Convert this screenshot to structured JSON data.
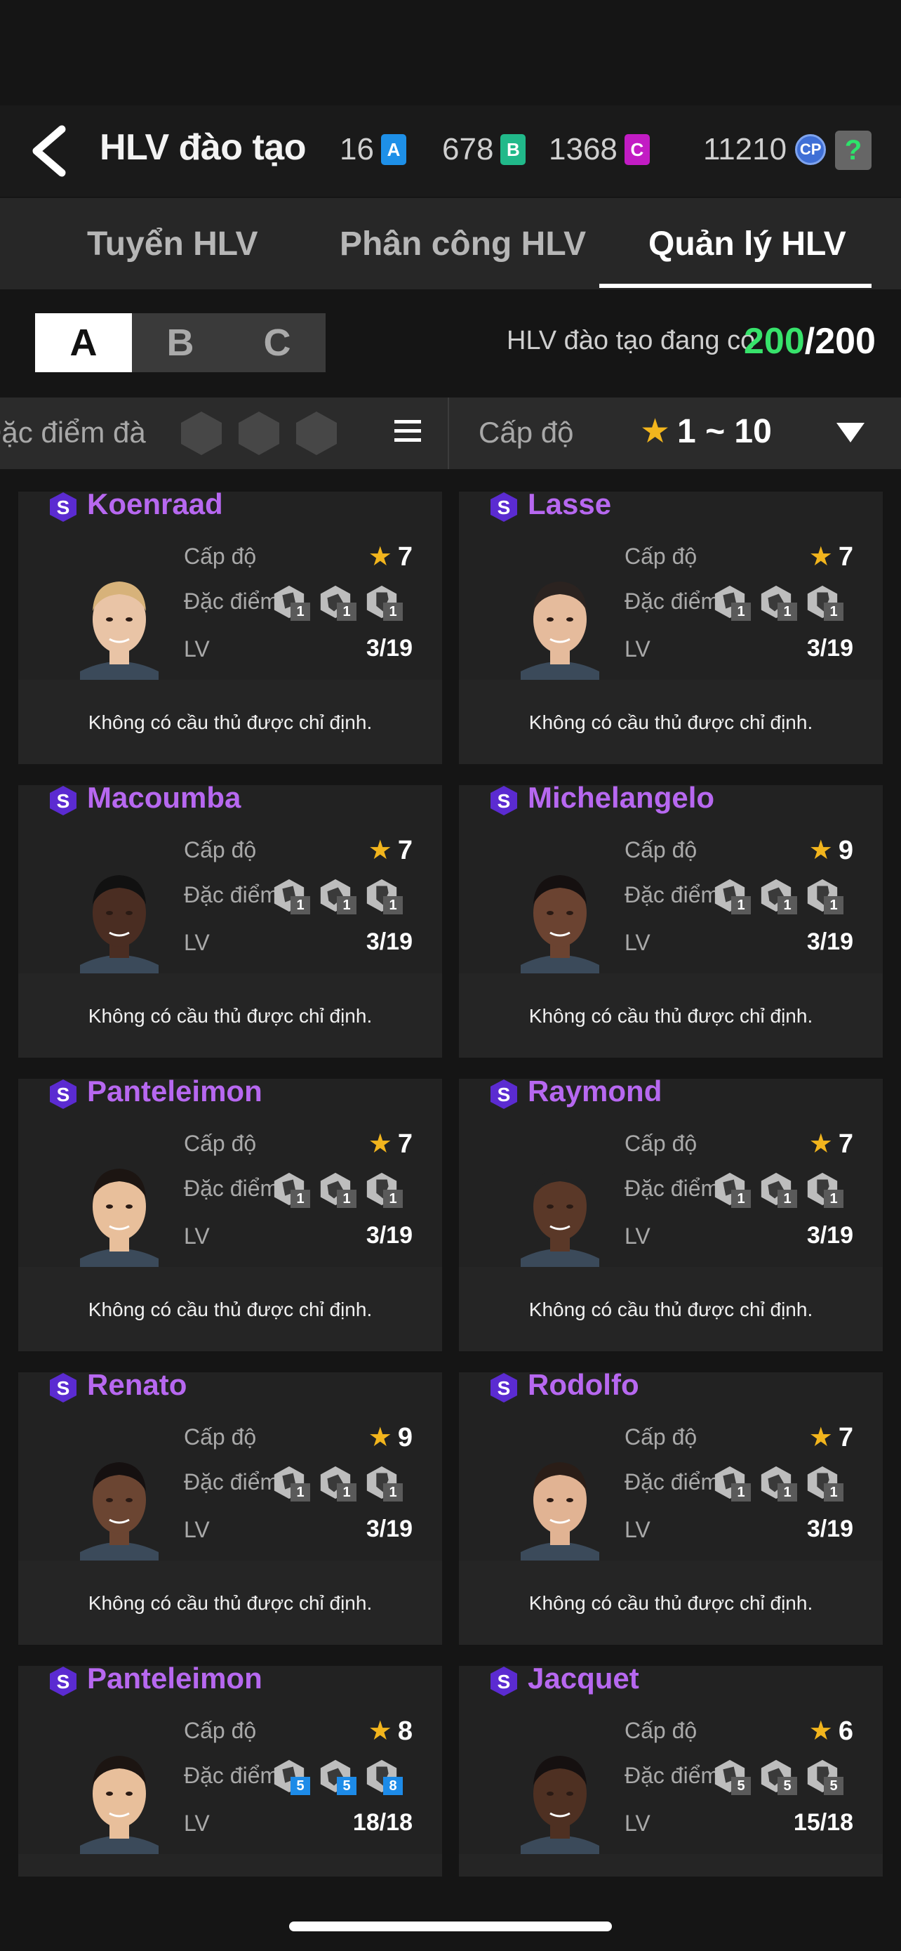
{
  "header": {
    "title": "HLV đào tạo",
    "currencies": [
      {
        "value": "16",
        "chip": "A",
        "color": "#1e90e8"
      },
      {
        "value": "678",
        "chip": "B",
        "color": "#21b98a"
      },
      {
        "value": "1368",
        "chip": "C",
        "color": "#c21cc4"
      }
    ],
    "cp_value": "11210",
    "cp_label": "CP",
    "help_label": "?"
  },
  "tabs": [
    {
      "label": "Tuyển HLV",
      "active": false
    },
    {
      "label": "Phân công HLV",
      "active": false
    },
    {
      "label": "Quản lý HLV",
      "active": true
    }
  ],
  "segments": [
    "A",
    "B",
    "C"
  ],
  "active_segment": "A",
  "count": {
    "label": "HLV đào tạo đang có",
    "current": "200",
    "max": "/200"
  },
  "filter": {
    "trait_label": "Đặc điểm đà",
    "level_label": "Cấp độ",
    "level_range": "1 ~ 10"
  },
  "card_labels": {
    "level": "Cấp độ",
    "traits": "Đặc điểm",
    "lv": "LV",
    "assignment": "Không có cầu thủ được chỉ định."
  },
  "coaches": [
    {
      "name": "Koenraad",
      "stars": "7",
      "lv": "3/19",
      "trait_levels": [
        "1",
        "1",
        "1"
      ],
      "skin": "#e9c4a6",
      "hair": "#d7b27a"
    },
    {
      "name": "Lasse",
      "stars": "7",
      "lv": "3/19",
      "trait_levels": [
        "1",
        "1",
        "1"
      ],
      "skin": "#e5bb9c",
      "hair": "#2b2320"
    },
    {
      "name": "Macoumba",
      "stars": "7",
      "lv": "3/19",
      "trait_levels": [
        "1",
        "1",
        "1"
      ],
      "skin": "#4a2d22",
      "hair": "#111"
    },
    {
      "name": "Michelangelo",
      "stars": "9",
      "lv": "3/19",
      "trait_levels": [
        "1",
        "1",
        "1"
      ],
      "skin": "#6b4331",
      "hair": "#151010"
    },
    {
      "name": "Panteleimon",
      "stars": "7",
      "lv": "3/19",
      "trait_levels": [
        "1",
        "1",
        "1"
      ],
      "skin": "#e8bf9b",
      "hair": "#1c1512"
    },
    {
      "name": "Raymond",
      "stars": "7",
      "lv": "3/19",
      "trait_levels": [
        "1",
        "1",
        "1"
      ],
      "skin": "#5a3828",
      "hair": "#222"
    },
    {
      "name": "Renato",
      "stars": "9",
      "lv": "3/19",
      "trait_levels": [
        "1",
        "1",
        "1"
      ],
      "skin": "#6b4532",
      "hair": "#151010"
    },
    {
      "name": "Rodolfo",
      "stars": "7",
      "lv": "3/19",
      "trait_levels": [
        "1",
        "1",
        "1"
      ],
      "skin": "#e1b393",
      "hair": "#2a1d17"
    },
    {
      "name": "Panteleimon",
      "stars": "8",
      "lv": "18/18",
      "trait_levels": [
        "5",
        "5",
        "8"
      ],
      "trait_highlight": true,
      "skin": "#e8bf9b",
      "hair": "#1c1512"
    },
    {
      "name": "Jacquet",
      "stars": "6",
      "lv": "15/18",
      "trait_levels": [
        "5",
        "5",
        "5"
      ],
      "skin": "#4e3022",
      "hair": "#151010"
    }
  ],
  "colors": {
    "accent_green": "#37e36b",
    "star": "#f2b51d",
    "name_purple": "#b768f0",
    "background": "#151515"
  }
}
